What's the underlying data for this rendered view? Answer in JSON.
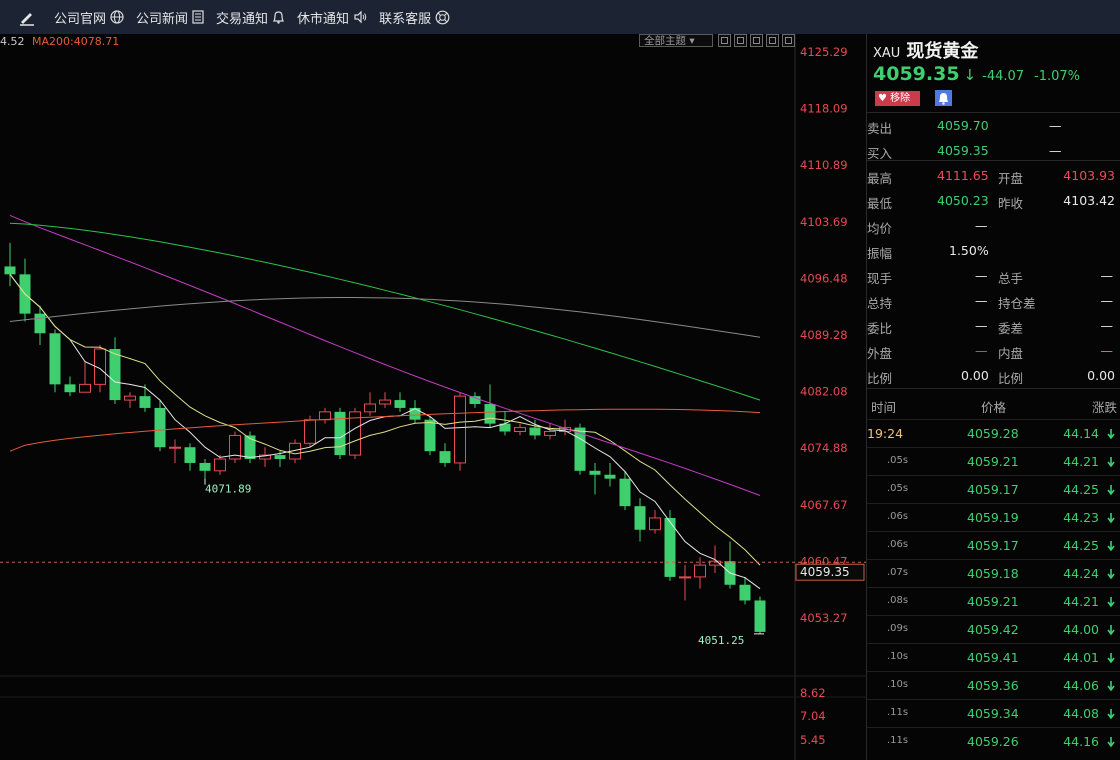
{
  "nav": {
    "items": [
      {
        "label": "公司官网",
        "icon": "globe-icon"
      },
      {
        "label": "公司新闻",
        "icon": "document-icon"
      },
      {
        "label": "交易通知",
        "icon": "bell-icon"
      },
      {
        "label": "休市通知",
        "icon": "speaker-icon"
      },
      {
        "label": "联系客服",
        "icon": "support-icon"
      }
    ]
  },
  "chart": {
    "ma_left": "4.52",
    "ma200": "MA200:4078.71",
    "theme_label": "全部主题",
    "current_price_tag": "4059.35",
    "low_label": "4051.25",
    "swing_low_label": "4071.89",
    "colors": {
      "up": "#e84a55",
      "down": "#3fcf6f",
      "ma200": "#e85a3a",
      "ma_purple": "#c43cc4",
      "ma_green": "#2ec24a",
      "ma_gray": "#8a8a8a",
      "ma_yellow": "#e0e08a",
      "ma_white": "#e8e8e8"
    }
  },
  "chart_data": {
    "type": "candlestick",
    "ylim": [
      4048,
      4127
    ],
    "y_ticks": [
      "4125.29",
      "4118.09",
      "4110.89",
      "4103.69",
      "4096.48",
      "4089.28",
      "4082.08",
      "4074.88",
      "4067.67",
      "4060.47",
      "4053.27"
    ],
    "sub_ticks": [
      "8.62",
      "7.04",
      "5.45"
    ],
    "ma_legend": [
      "MA200:4078.71"
    ],
    "candles": [
      [
        4098,
        4097,
        4101,
        4095.5
      ],
      [
        4097,
        4092,
        4099,
        4091
      ],
      [
        4092,
        4089.5,
        4093,
        4088
      ],
      [
        4089.5,
        4083,
        4090,
        4082
      ],
      [
        4083,
        4082,
        4084,
        4081.5
      ],
      [
        4082,
        4083,
        4086,
        4082
      ],
      [
        4083,
        4087.5,
        4088,
        4082
      ],
      [
        4087.5,
        4081,
        4089,
        4080.5
      ],
      [
        4081,
        4081.5,
        4082,
        4080
      ],
      [
        4081.5,
        4080,
        4083,
        4079.5
      ],
      [
        4080,
        4075,
        4081,
        4074.5
      ],
      [
        4075,
        4075,
        4076,
        4073
      ],
      [
        4075,
        4073,
        4075.5,
        4072
      ],
      [
        4073,
        4072,
        4073.5,
        4071
      ],
      [
        4072,
        4073.5,
        4074,
        4071.5
      ],
      [
        4073.5,
        4076.5,
        4077,
        4073
      ],
      [
        4076.5,
        4073.5,
        4077,
        4073
      ],
      [
        4073.5,
        4074,
        4075,
        4072.5
      ],
      [
        4074,
        4073.5,
        4074.5,
        4072.5
      ],
      [
        4073.5,
        4075.5,
        4076,
        4073
      ],
      [
        4075.5,
        4078.5,
        4079,
        4075
      ],
      [
        4078.5,
        4079.5,
        4080,
        4078
      ],
      [
        4079.5,
        4074,
        4080,
        4073.5
      ],
      [
        4074,
        4079.5,
        4080,
        4073.5
      ],
      [
        4079.5,
        4080.5,
        4082,
        4079
      ],
      [
        4080.5,
        4081,
        4082,
        4080
      ],
      [
        4081,
        4080,
        4082,
        4079.5
      ],
      [
        4080,
        4078.5,
        4081,
        4078
      ],
      [
        4078.5,
        4074.5,
        4079,
        4074
      ],
      [
        4074.5,
        4073,
        4075.5,
        4072.5
      ],
      [
        4073,
        4081.5,
        4082,
        4072
      ],
      [
        4081.5,
        4080.5,
        4082,
        4080
      ],
      [
        4080.5,
        4078,
        4083,
        4077.5
      ],
      [
        4078,
        4077,
        4079.5,
        4076.5
      ],
      [
        4077,
        4077.5,
        4078,
        4076.5
      ],
      [
        4077.5,
        4076.5,
        4078.5,
        4076
      ],
      [
        4076.5,
        4077,
        4078,
        4076
      ],
      [
        4077,
        4077.5,
        4078.5,
        4076.5
      ],
      [
        4077.5,
        4072,
        4078,
        4071.5
      ],
      [
        4072,
        4071.5,
        4073,
        4069
      ],
      [
        4071.5,
        4071,
        4073,
        4070
      ],
      [
        4071,
        4067.5,
        4072,
        4067
      ],
      [
        4067.5,
        4064.5,
        4068.5,
        4063
      ],
      [
        4064.5,
        4066,
        4067,
        4064
      ],
      [
        4066,
        4058.5,
        4067,
        4058
      ],
      [
        4058.5,
        4058.5,
        4060,
        4055.5
      ],
      [
        4058.5,
        4060,
        4061,
        4057
      ],
      [
        4060,
        4060.5,
        4062.5,
        4059
      ],
      [
        4060.5,
        4057.5,
        4063,
        4057
      ],
      [
        4057.5,
        4055.5,
        4058.5,
        4055
      ],
      [
        4055.5,
        4051.5,
        4056,
        4051.25
      ]
    ]
  },
  "panel": {
    "symbol_code": "XAU",
    "symbol_name": "现货黄金",
    "price": "4059.35",
    "arrow": "↓",
    "change": "-44.07",
    "change_pct": "-1.07%",
    "remove_label": "移除",
    "sell_label": "卖出",
    "sell": "4059.70",
    "sell_vol": "—",
    "buy_label": "买入",
    "buy": "4059.35",
    "buy_vol": "—",
    "high_label": "最高",
    "high": "4111.65",
    "open_label": "开盘",
    "open": "4103.93",
    "low_label": "最低",
    "low": "4050.23",
    "prev_label": "昨收",
    "prev": "4103.42",
    "avg_label": "均价",
    "avg": "—",
    "amp_label": "振幅",
    "amp": "1.50%",
    "xianshou_label": "现手",
    "xianshou": "—",
    "zongshou_label": "总手",
    "zongshou": "—",
    "zongchi_label": "总持",
    "zongchi": "—",
    "chicang_label": "持仓差",
    "chicang": "—",
    "weibi_label": "委比",
    "weibi": "—",
    "weicha_label": "委差",
    "weicha": "—",
    "waipan_label": "外盘",
    "waipan": "—",
    "neipan_label": "内盘",
    "neipan": "—",
    "ratio_label": "比例",
    "ratio1": "0.00",
    "ratio2_label": "比例",
    "ratio2": "0.00",
    "col_time": "时间",
    "col_price": "价格",
    "col_change": "涨跌"
  },
  "ticks": [
    {
      "time": "19:24",
      "price": "4059.28",
      "change": "44.14"
    },
    {
      "time": ".05s",
      "price": "4059.21",
      "change": "44.21"
    },
    {
      "time": ".05s",
      "price": "4059.17",
      "change": "44.25"
    },
    {
      "time": ".06s",
      "price": "4059.19",
      "change": "44.23"
    },
    {
      "time": ".06s",
      "price": "4059.17",
      "change": "44.25"
    },
    {
      "time": ".07s",
      "price": "4059.18",
      "change": "44.24"
    },
    {
      "time": ".08s",
      "price": "4059.21",
      "change": "44.21"
    },
    {
      "time": ".09s",
      "price": "4059.42",
      "change": "44.00"
    },
    {
      "time": ".10s",
      "price": "4059.41",
      "change": "44.01"
    },
    {
      "time": ".10s",
      "price": "4059.36",
      "change": "44.06"
    },
    {
      "time": ".11s",
      "price": "4059.34",
      "change": "44.08"
    },
    {
      "time": ".11s",
      "price": "4059.26",
      "change": "44.16"
    }
  ]
}
